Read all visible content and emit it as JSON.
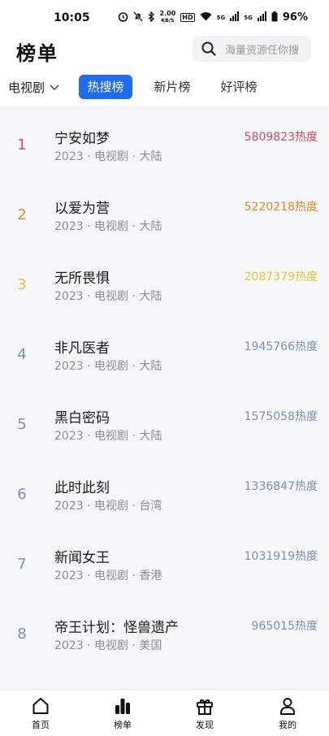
{
  "status_bar": {
    "time": "10:05",
    "net_speed_value": "2.00",
    "net_speed_unit": "KB/S",
    "hd_badge": "HD",
    "signal_1": "5G",
    "signal_2": "5G",
    "battery": "96%"
  },
  "header": {
    "title": "榜单",
    "search_placeholder": "海量资源任你搜"
  },
  "filter": {
    "category": "电视剧",
    "tabs": [
      {
        "label": "热搜榜",
        "active": true
      },
      {
        "label": "新片榜",
        "active": false
      },
      {
        "label": "好评榜",
        "active": false
      }
    ]
  },
  "rankings": [
    {
      "rank": "1",
      "title": "宁安如梦",
      "meta": "2023 · 电视剧 · 大陆",
      "heat": "5809823热度",
      "color": "#d14a5a"
    },
    {
      "rank": "2",
      "title": "以爱为营",
      "meta": "2023 · 电视剧 · 大陆",
      "heat": "5220218热度",
      "color": "#d98a2b"
    },
    {
      "rank": "3",
      "title": "无所畏惧",
      "meta": "2023 · 电视剧 · 大陆",
      "heat": "2087379热度",
      "color": "#e7c43a"
    },
    {
      "rank": "4",
      "title": "非凡医者",
      "meta": "2023 · 电视剧 · 大陆",
      "heat": "1945766热度",
      "color": "#7d8fb3"
    },
    {
      "rank": "5",
      "title": "黑白密码",
      "meta": "2023 · 电视剧 · 大陆",
      "heat": "1575058热度",
      "color": "#7d8fb3"
    },
    {
      "rank": "6",
      "title": "此时此刻",
      "meta": "2023 · 电视剧 · 台湾",
      "heat": "1336847热度",
      "color": "#7d8fb3"
    },
    {
      "rank": "7",
      "title": "新闻女王",
      "meta": "2023 · 电视剧 · 香港",
      "heat": "1031919热度",
      "color": "#7d8fb3"
    },
    {
      "rank": "8",
      "title": "帝王计划：怪兽遗产",
      "meta": "2023 · 电视剧 · 美国",
      "heat": "965015热度",
      "color": "#7d8fb3"
    }
  ],
  "bottom_nav": [
    {
      "label": "首页",
      "icon": "home-icon"
    },
    {
      "label": "榜单",
      "icon": "chart-icon"
    },
    {
      "label": "发现",
      "icon": "gift-icon"
    },
    {
      "label": "我的",
      "icon": "user-icon"
    }
  ]
}
